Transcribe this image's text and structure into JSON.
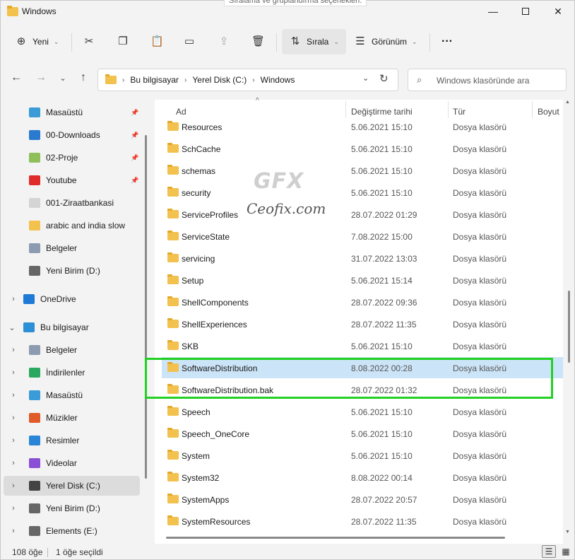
{
  "window": {
    "title": "Windows",
    "tooltip": "Sıralama ve gruplandırma seçenekleri."
  },
  "toolbar": {
    "new_label": "Yeni",
    "sort_label": "Sırala",
    "view_label": "Görünüm",
    "more_label": "···"
  },
  "address": {
    "crumbs": [
      "Bu bilgisayar",
      "Yerel Disk (C:)",
      "Windows"
    ],
    "search_placeholder": "Windows klasöründe ara"
  },
  "sidebar": {
    "items": [
      {
        "label": "Masaüstü",
        "icon": "desktop-icon",
        "color": "#3a9bd6",
        "pinned": true
      },
      {
        "label": "00-Downloads",
        "icon": "download-icon",
        "color": "#2a7bd0",
        "pinned": true
      },
      {
        "label": "02-Proje",
        "icon": "project-folder-icon",
        "color": "#8fbf5a",
        "pinned": true
      },
      {
        "label": "Youtube",
        "icon": "youtube-icon",
        "color": "#e02b2b",
        "pinned": true
      },
      {
        "label": "001-Ziraatbankasi",
        "icon": "folder-icon",
        "color": "#d4d4d4",
        "pinned": false
      },
      {
        "label": "arabic and india slow",
        "icon": "folder-icon",
        "color": "#f2c14e",
        "pinned": false
      },
      {
        "label": "Belgeler",
        "icon": "documents-icon",
        "color": "#8c9bb0",
        "pinned": false
      },
      {
        "label": "Yeni Birim (D:)",
        "icon": "drive-icon",
        "color": "#666666",
        "pinned": false
      },
      {
        "label": "OneDrive",
        "icon": "onedrive-icon",
        "color": "#1e7ad6",
        "pinned": false
      },
      {
        "label": "Bu bilgisayar",
        "icon": "this-pc-icon",
        "color": "#2d8fd6",
        "pinned": false
      },
      {
        "label": "Belgeler",
        "icon": "documents-icon",
        "color": "#8c9bb0",
        "pinned": false
      },
      {
        "label": "İndirilenler",
        "icon": "download-icon",
        "color": "#2aa860",
        "pinned": false
      },
      {
        "label": "Masaüstü",
        "icon": "desktop-icon",
        "color": "#3a9bd6",
        "pinned": false
      },
      {
        "label": "Müzikler",
        "icon": "music-icon",
        "color": "#e05a2a",
        "pinned": false
      },
      {
        "label": "Resimler",
        "icon": "pictures-icon",
        "color": "#2b85d6",
        "pinned": false
      },
      {
        "label": "Videolar",
        "icon": "videos-icon",
        "color": "#8a4fd6",
        "pinned": false
      },
      {
        "label": "Yerel Disk (C:)",
        "icon": "windows-drive-icon",
        "color": "#444444",
        "pinned": false
      },
      {
        "label": "Yeni Birim (D:)",
        "icon": "drive-icon",
        "color": "#666666",
        "pinned": false
      },
      {
        "label": "Elements (E:)",
        "icon": "drive-icon",
        "color": "#666666",
        "pinned": false
      }
    ]
  },
  "columns": {
    "name": "Ad",
    "date": "Değiştirme tarihi",
    "type": "Tür",
    "size": "Boyut"
  },
  "files": [
    {
      "name": "Resources",
      "date": "5.06.2021 15:10",
      "type": "Dosya klasörü"
    },
    {
      "name": "SchCache",
      "date": "5.06.2021 15:10",
      "type": "Dosya klasörü"
    },
    {
      "name": "schemas",
      "date": "5.06.2021 15:10",
      "type": "Dosya klasörü"
    },
    {
      "name": "security",
      "date": "5.06.2021 15:10",
      "type": "Dosya klasörü"
    },
    {
      "name": "ServiceProfiles",
      "date": "28.07.2022 01:29",
      "type": "Dosya klasörü"
    },
    {
      "name": "ServiceState",
      "date": "7.08.2022 15:00",
      "type": "Dosya klasörü"
    },
    {
      "name": "servicing",
      "date": "31.07.2022 13:03",
      "type": "Dosya klasörü"
    },
    {
      "name": "Setup",
      "date": "5.06.2021 15:14",
      "type": "Dosya klasörü"
    },
    {
      "name": "ShellComponents",
      "date": "28.07.2022 09:36",
      "type": "Dosya klasörü"
    },
    {
      "name": "ShellExperiences",
      "date": "28.07.2022 11:35",
      "type": "Dosya klasörü"
    },
    {
      "name": "SKB",
      "date": "5.06.2021 15:10",
      "type": "Dosya klasörü"
    },
    {
      "name": "SoftwareDistribution",
      "date": "8.08.2022 00:28",
      "type": "Dosya klasörü",
      "selected": true
    },
    {
      "name": "SoftwareDistribution.bak",
      "date": "28.07.2022 01:32",
      "type": "Dosya klasörü"
    },
    {
      "name": "Speech",
      "date": "5.06.2021 15:10",
      "type": "Dosya klasörü"
    },
    {
      "name": "Speech_OneCore",
      "date": "5.06.2021 15:10",
      "type": "Dosya klasörü"
    },
    {
      "name": "System",
      "date": "5.06.2021 15:10",
      "type": "Dosya klasörü"
    },
    {
      "name": "System32",
      "date": "8.08.2022 00:14",
      "type": "Dosya klasörü"
    },
    {
      "name": "SystemApps",
      "date": "28.07.2022 20:57",
      "type": "Dosya klasörü"
    },
    {
      "name": "SystemResources",
      "date": "28.07.2022 11:35",
      "type": "Dosya klasörü"
    }
  ],
  "watermark": {
    "logo": "GFX",
    "text": "Ceofix.com"
  },
  "status": {
    "count": "108 öğe",
    "selection": "1 öğe seçildi"
  },
  "colors": {
    "selected_row": "#cce4f7",
    "highlight_box": "#22d122",
    "folder": "#f2c14e"
  }
}
